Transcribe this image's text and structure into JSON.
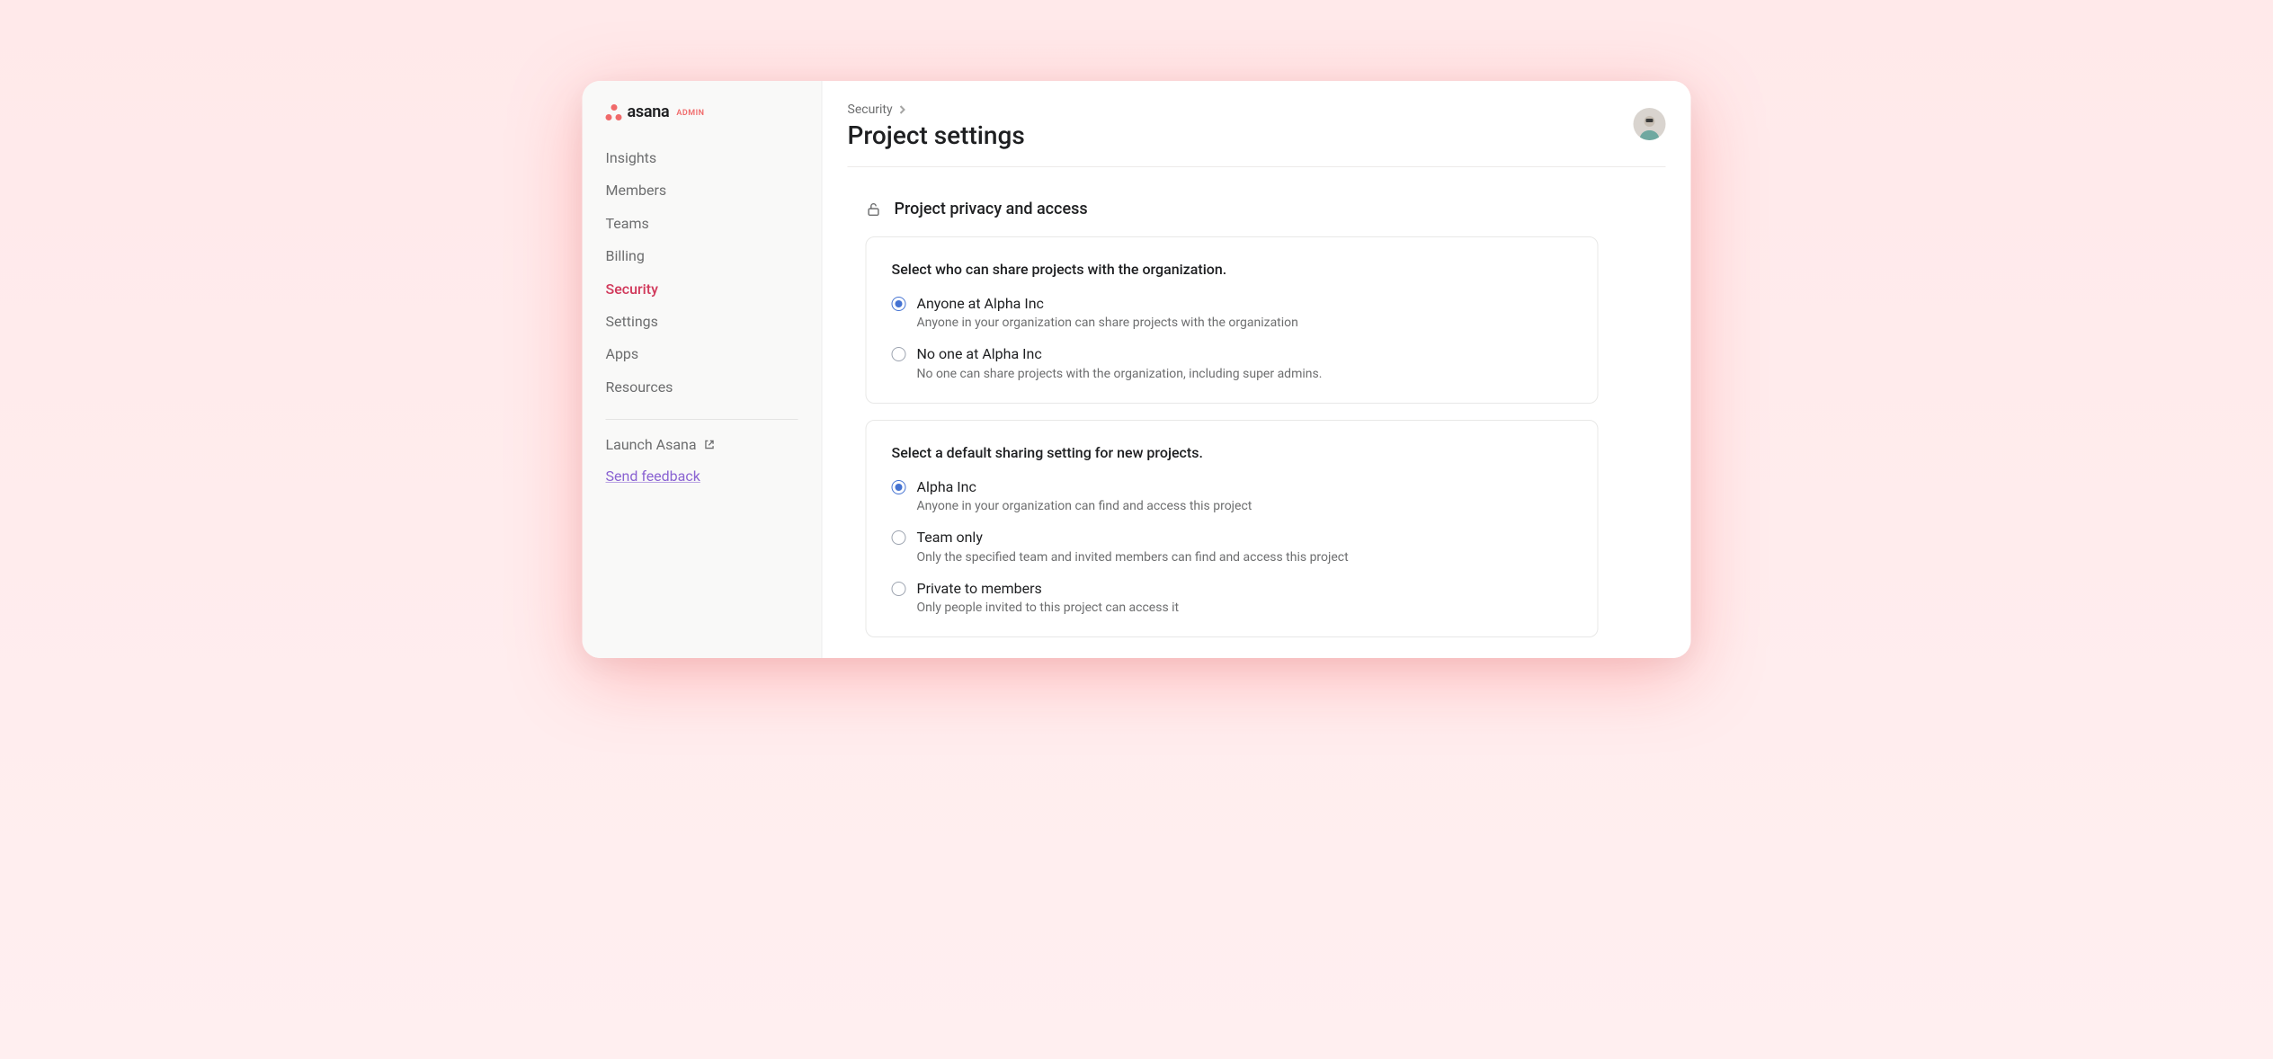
{
  "brand": {
    "name": "asana",
    "tag": "ADMIN"
  },
  "sidebar": {
    "items": [
      {
        "label": "Insights"
      },
      {
        "label": "Members"
      },
      {
        "label": "Teams"
      },
      {
        "label": "Billing"
      },
      {
        "label": "Security"
      },
      {
        "label": "Settings"
      },
      {
        "label": "Apps"
      },
      {
        "label": "Resources"
      }
    ],
    "launch": "Launch Asana",
    "feedback": "Send feedback"
  },
  "breadcrumb": {
    "parent": "Security"
  },
  "page": {
    "title": "Project settings"
  },
  "section": {
    "title": "Project privacy and access"
  },
  "card1": {
    "title": "Select who can share projects with the organization.",
    "opt1": {
      "label": "Anyone at Alpha Inc",
      "desc": "Anyone in your organization can share projects with the organization"
    },
    "opt2": {
      "label": "No one at Alpha Inc",
      "desc": "No one can share projects with the organization, including super admins."
    }
  },
  "card2": {
    "title": "Select a default sharing setting for new projects.",
    "opt1": {
      "label": "Alpha Inc",
      "desc": "Anyone in your organization can find and access this project"
    },
    "opt2": {
      "label": "Team only",
      "desc": "Only the specified team and invited members can find and access this project"
    },
    "opt3": {
      "label": "Private to members",
      "desc": "Only people invited to this project can access it"
    }
  }
}
